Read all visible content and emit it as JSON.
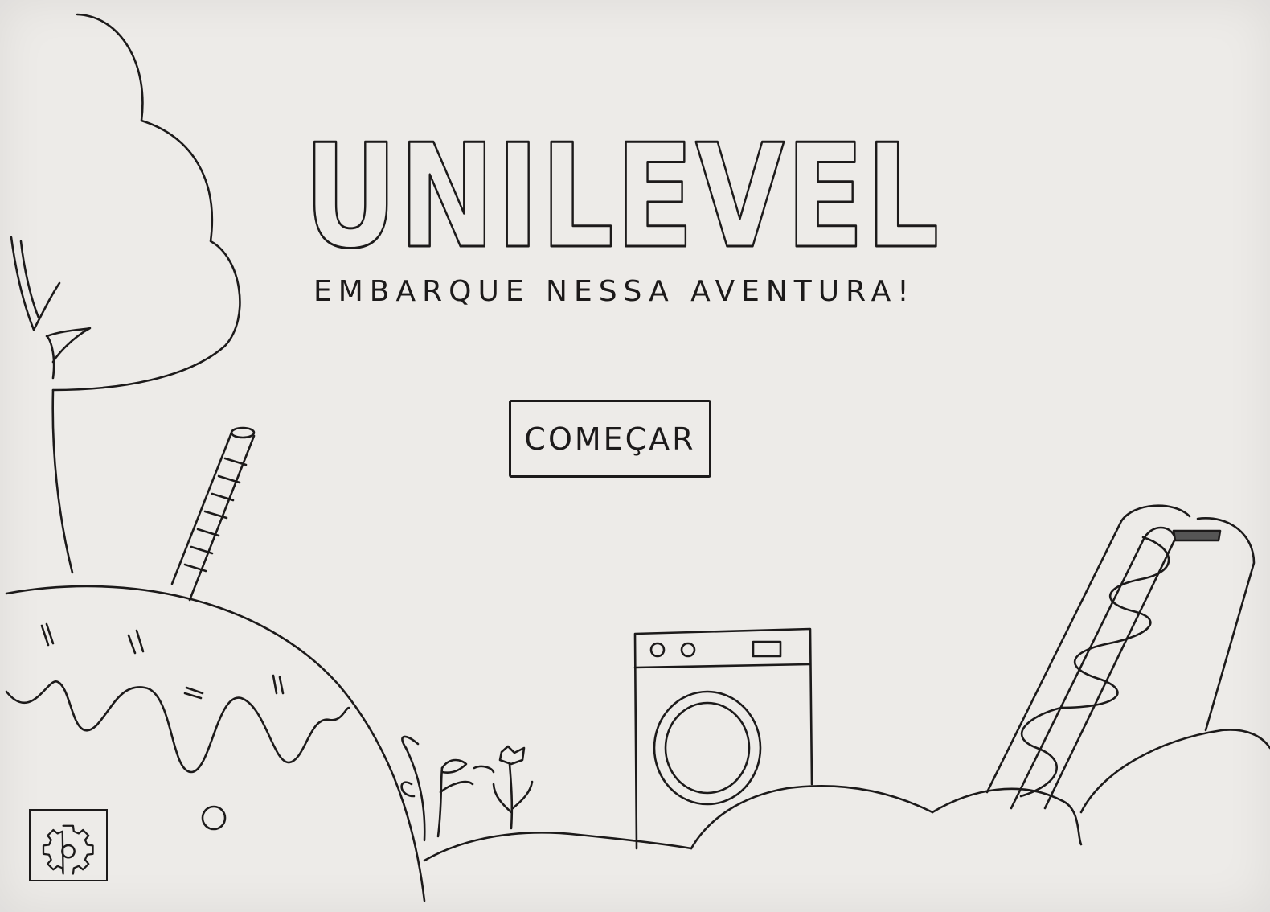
{
  "game": {
    "title": "UNILEVEL",
    "subtitle": "EMBARQUE NESSA AVENTURA!",
    "start_button_label": "COMEÇAR",
    "settings_icon": "gear-icon"
  },
  "scene": {
    "props": [
      "tree",
      "donut-hill",
      "straw",
      "plants",
      "flower",
      "washing-machine",
      "slide"
    ]
  },
  "colors": {
    "paper": "#edebe8",
    "ink": "#1c1a1a"
  }
}
